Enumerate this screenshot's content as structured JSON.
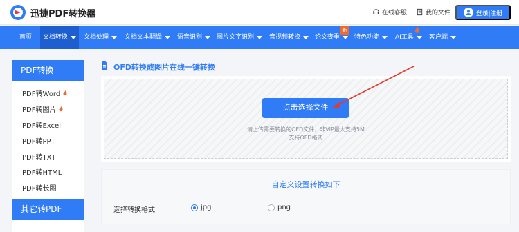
{
  "header": {
    "brand": "迅捷PDF转换器",
    "online_service": "在线客服",
    "my_files": "我的文件",
    "login_label": "登录|注册"
  },
  "nav": {
    "items": [
      {
        "label": "首页",
        "caret": false
      },
      {
        "label": "文档转换",
        "caret": true,
        "active": true
      },
      {
        "label": "文档处理",
        "caret": true
      },
      {
        "label": "文档文本翻译",
        "caret": true
      },
      {
        "label": "语音识别",
        "caret": true
      },
      {
        "label": "图片文字识别",
        "caret": true
      },
      {
        "label": "音视频转换",
        "caret": true
      },
      {
        "label": "论文查重",
        "caret": true
      },
      {
        "label": "特色功能",
        "caret": true
      },
      {
        "label": "AI工具",
        "caret": true
      },
      {
        "label": "客户端",
        "caret": true
      }
    ],
    "new_badge": "新"
  },
  "sidebar": {
    "group1_title": "PDF转换",
    "group1_items": [
      {
        "label": "PDF转Word",
        "hot": true
      },
      {
        "label": "PDF转图片",
        "hot": true
      },
      {
        "label": "PDF转Excel",
        "hot": false
      },
      {
        "label": "PDF转PPT",
        "hot": false
      },
      {
        "label": "PDF转TXT",
        "hot": false
      },
      {
        "label": "PDF转HTML",
        "hot": false
      },
      {
        "label": "PDF转长图",
        "hot": false
      }
    ],
    "group2_title": "其它转PDF"
  },
  "main": {
    "title": "OFD转换成图片在线一键转换",
    "pick_button": "点击选择文件",
    "hint_line1": "请上传需要转换的OFD文件，非VIP最大支持5M",
    "hint_line2": "支持OFD格式",
    "settings_title": "自定义设置转换如下",
    "format_label": "选择转换格式",
    "formats": [
      {
        "label": "jpg",
        "selected": true
      },
      {
        "label": "png",
        "selected": false
      }
    ]
  },
  "colors": {
    "accent": "#2f7cf6",
    "hot": "#f06a2b",
    "annotation_arrow": "#e23b2e"
  }
}
